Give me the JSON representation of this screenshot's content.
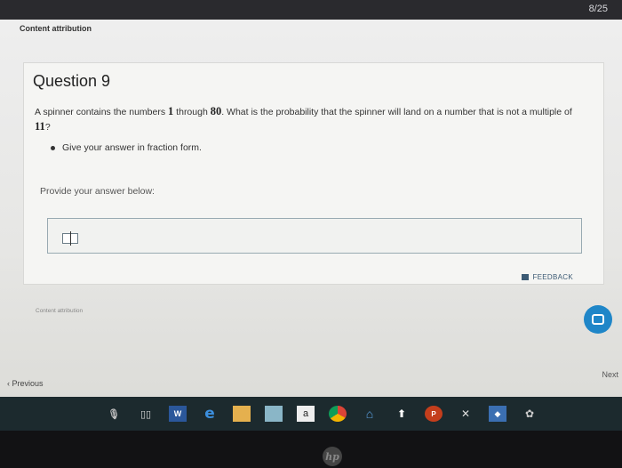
{
  "header": {
    "page_counter": "8/25"
  },
  "content_attribution_top": "Content attribution",
  "question": {
    "title": "Question 9",
    "text_before_1": "A spinner contains the numbers ",
    "num_1": "1",
    "text_through": " through ",
    "num_80": "80",
    "text_middle": ". What is the probability that the spinner will land on a number that is not a multiple of ",
    "num_11": "11",
    "text_end": "?",
    "bullet": "Give your answer in fraction form."
  },
  "answer": {
    "prompt": "Provide your answer below:",
    "value": ""
  },
  "feedback_label": "FEEDBACK",
  "content_attribution_bottom": "Content attribution",
  "navigation": {
    "next_label": "Next",
    "previous_label": "Previous"
  },
  "taskbar": {
    "icons": [
      "microphone-icon",
      "task-view-icon",
      "word-icon",
      "edge-icon",
      "file-explorer-icon",
      "store-icon",
      "amazon-icon",
      "chrome-icon",
      "home-icon",
      "arrow-icon",
      "powerpoint-icon",
      "graph-icon",
      "app-icon",
      "paint-icon"
    ],
    "amazon_letter": "a",
    "word_letter": "W"
  },
  "colors": {
    "accent": "#1f86c8",
    "feedback": "#3c5a74",
    "taskbar": "#1c2a2e"
  }
}
